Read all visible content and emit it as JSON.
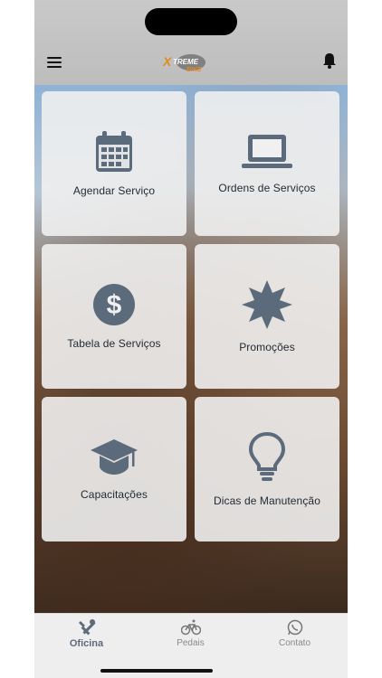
{
  "app": {
    "brand": "XTREME BIKE"
  },
  "header": {
    "menu_icon": "hamburger-icon",
    "notification_icon": "bell-icon"
  },
  "tiles": [
    {
      "label": "Agendar Serviço",
      "icon": "calendar-icon"
    },
    {
      "label": "Ordens de Serviços",
      "icon": "laptop-icon"
    },
    {
      "label": "Tabela de Serviços",
      "icon": "dollar-icon"
    },
    {
      "label": "Promoções",
      "icon": "starburst-icon"
    },
    {
      "label": "Capacitações",
      "icon": "graduation-cap-icon"
    },
    {
      "label": "Dicas de Manutenção",
      "icon": "lightbulb-icon"
    }
  ],
  "tabbar": {
    "tabs": [
      {
        "label": "Oficina",
        "icon": "tools-icon",
        "active": true
      },
      {
        "label": "Pedais",
        "icon": "bicycle-icon",
        "active": false
      },
      {
        "label": "Contato",
        "icon": "whatsapp-icon",
        "active": false
      }
    ]
  },
  "colors": {
    "icon": "#5c6b7c",
    "tile_bg": "#f0f0f0",
    "header_bg": "#c4c4c4"
  }
}
